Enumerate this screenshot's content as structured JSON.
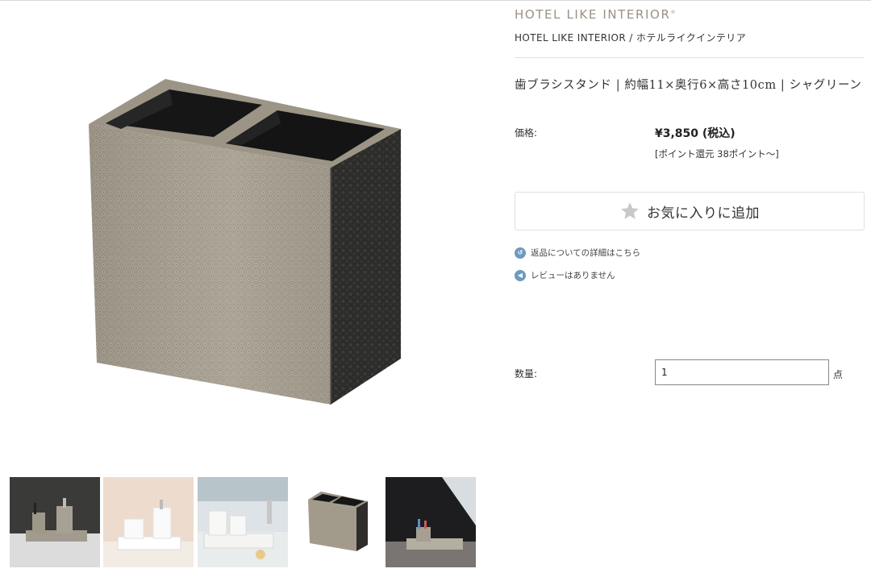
{
  "brand": {
    "logo_text": "HOTEL LIKE INTERIOR",
    "logo_mark": "®",
    "subtitle": "HOTEL LIKE INTERIOR / ホテルライクインテリア"
  },
  "product": {
    "title": "歯ブラシスタンド | 約幅11×奥行6×高さ10cm | シャグリーン",
    "price_label": "価格:",
    "price": "¥3,850 (税込)",
    "points": "[ポイント還元 38ポイント〜]"
  },
  "favorite": {
    "label": "お気に入りに追加"
  },
  "links": {
    "returns": "返品についての詳細はこちら",
    "reviews": "レビューはありません"
  },
  "quantity": {
    "label": "数量:",
    "value": "1",
    "unit": "点"
  },
  "colors": {
    "brand": "#9a9186",
    "link_icon": "#6f9ac0",
    "star": "#c8c8c8"
  },
  "gallery": {
    "thumbnails": [
      "bath-set-dark-background",
      "bath-set-white-beige",
      "bath-set-white-counter",
      "toothbrush-stand",
      "bath-set-gray-tray"
    ]
  }
}
